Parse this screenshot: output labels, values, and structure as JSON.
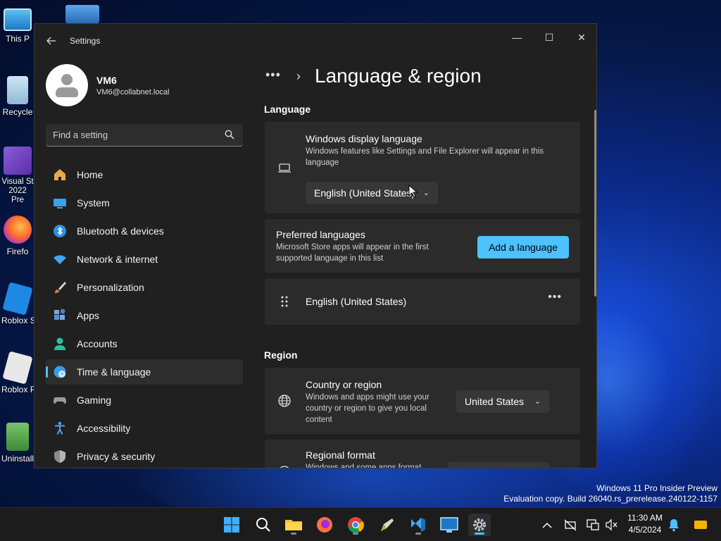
{
  "desktop": {
    "icons": [
      {
        "label": "This P"
      },
      {
        "label": "Recycle"
      },
      {
        "label": "Visual St 2022 Pre"
      },
      {
        "label": "Firefo"
      },
      {
        "label": "Roblox S"
      },
      {
        "label": "Roblox P"
      },
      {
        "label": "Uninstall"
      }
    ],
    "watermark_line1": "Windows 11 Pro Insider Preview",
    "watermark_line2": "Evaluation copy. Build 26040.rs_prerelease.240122-1157"
  },
  "window": {
    "title": "Settings",
    "controls": {
      "minimize": "—",
      "maximize": "☐",
      "close": "✕"
    }
  },
  "profile": {
    "name": "VM6",
    "email": "VM6@collabnet.local"
  },
  "search": {
    "placeholder": "Find a setting"
  },
  "nav": {
    "items": [
      {
        "label": "Home",
        "icon": "home-icon",
        "color": "#e8a84b"
      },
      {
        "label": "System",
        "icon": "system-icon",
        "color": "#3aa0e8"
      },
      {
        "label": "Bluetooth & devices",
        "icon": "bluetooth-icon",
        "color": "#2f8de4"
      },
      {
        "label": "Network & internet",
        "icon": "wifi-icon",
        "color": "#3fa6f0"
      },
      {
        "label": "Personalization",
        "icon": "brush-icon",
        "color": "#e07b39"
      },
      {
        "label": "Apps",
        "icon": "apps-icon",
        "color": "#5b8fd9"
      },
      {
        "label": "Accounts",
        "icon": "accounts-icon",
        "color": "#2fbf9a"
      },
      {
        "label": "Time & language",
        "icon": "globe-clock-icon",
        "color": "#3a9be8"
      },
      {
        "label": "Gaming",
        "icon": "gamepad-icon",
        "color": "#9a9a9a"
      },
      {
        "label": "Accessibility",
        "icon": "accessibility-icon",
        "color": "#4ba3e8"
      },
      {
        "label": "Privacy & security",
        "icon": "shield-icon",
        "color": "#8a8a8a"
      }
    ],
    "active_index": 7
  },
  "breadcrumb": {
    "dots": "•••",
    "chevron": "›",
    "title": "Language & region"
  },
  "language": {
    "section_title": "Language",
    "display_language": {
      "title": "Windows display language",
      "description": "Windows features like Settings and File Explorer will appear in this language",
      "selected": "English (United States)",
      "icon": "laptop-icon"
    },
    "preferred": {
      "title": "Preferred languages",
      "description": "Microsoft Store apps will appear in the first supported language in this list",
      "add_button": "Add a language"
    },
    "installed": [
      {
        "name": "English (United States)",
        "more": "•••",
        "icon": "drag-handle-icon"
      }
    ]
  },
  "region": {
    "section_title": "Region",
    "country": {
      "title": "Country or region",
      "description": "Windows and apps might use your country or region to give you local content",
      "selected": "United States",
      "icon": "globe-icon"
    },
    "format": {
      "title": "Regional format",
      "description": "Windows and some apps format"
    }
  },
  "taskbar": {
    "time": "11:30 AM",
    "date": "4/5/2024",
    "accent": "#4cc2ff"
  }
}
